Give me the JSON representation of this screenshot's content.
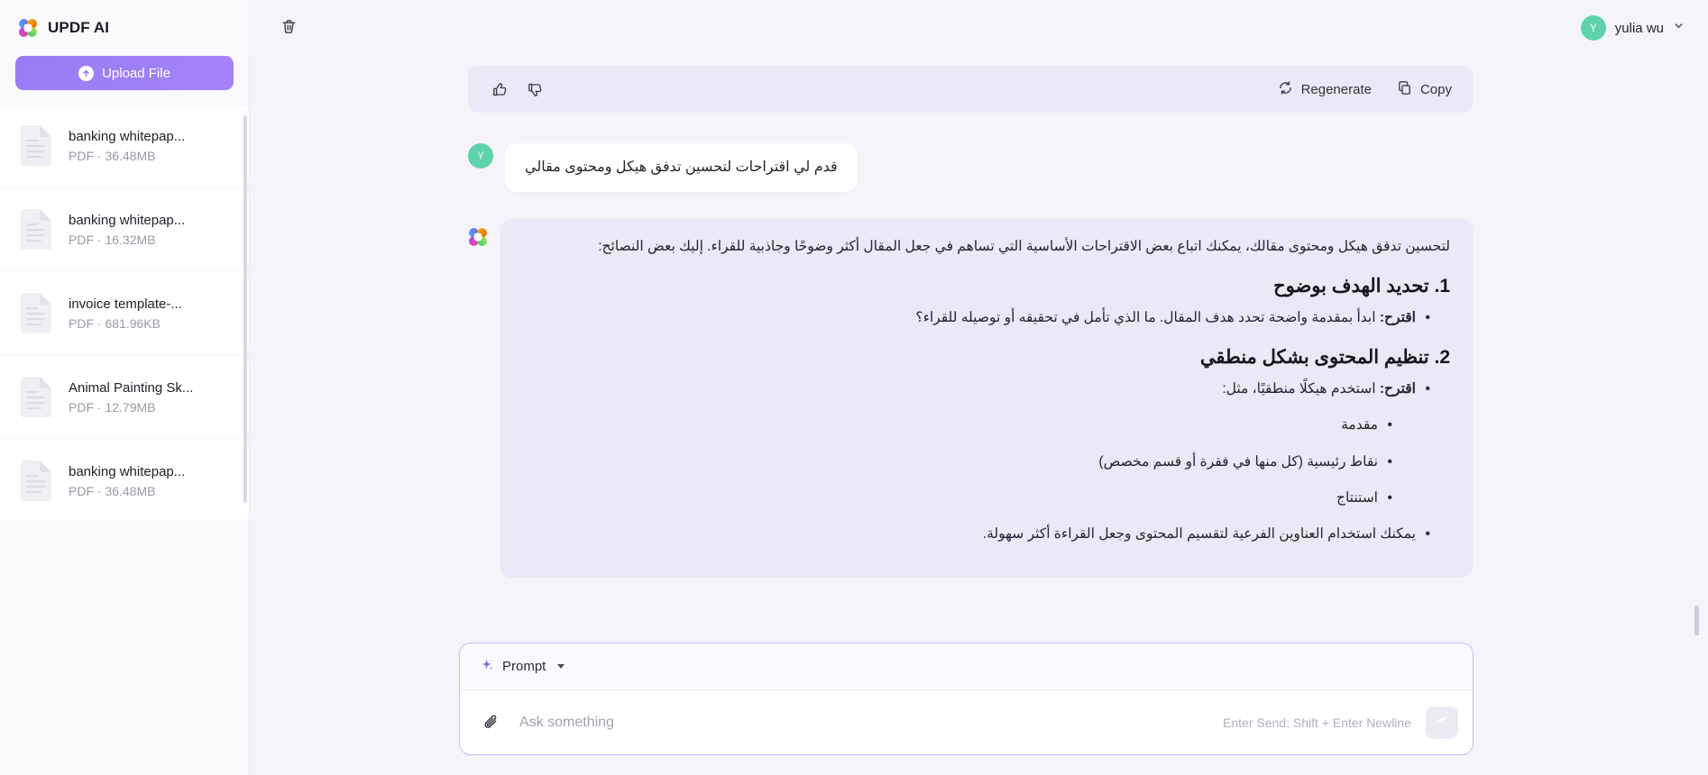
{
  "sidebar": {
    "brand": {
      "name": "UPDF AI",
      "logo_icon": "updf-clover-logo-icon"
    },
    "upload": {
      "label": "Upload File",
      "icon": "upload-arrow-circle-icon"
    },
    "files": [
      {
        "name": "banking whitepap...",
        "meta": "PDF · 36.48MB",
        "icon": "pdf-document-icon"
      },
      {
        "name": "banking whitepap...",
        "meta": "PDF · 16.32MB",
        "icon": "pdf-document-icon"
      },
      {
        "name": "invoice template-...",
        "meta": "PDF · 681.96KB",
        "icon": "pdf-document-icon"
      },
      {
        "name": "Animal Painting Sk...",
        "meta": "PDF · 12.79MB",
        "icon": "pdf-document-icon"
      },
      {
        "name": "banking whitepap...",
        "meta": "PDF · 36.48MB",
        "icon": "pdf-document-icon"
      }
    ]
  },
  "topbar": {
    "trash_icon": "trash-bin-icon",
    "user": {
      "name": "yulia wu",
      "initial": "Y",
      "chevron_icon": "chevron-down-icon"
    }
  },
  "message_toolbar": {
    "thumbs_up_icon": "thumbs-up-icon",
    "thumbs_down_icon": "thumbs-down-icon",
    "regenerate_label": "Regenerate",
    "regenerate_icon": "refresh-icon",
    "copy_label": "Copy",
    "copy_icon": "copy-icon"
  },
  "user_message": {
    "avatar_initial": "Y",
    "text": "قدم لي اقتراحات لتحسين تدفق هيكل ومحتوى مقالي"
  },
  "ai_message": {
    "avatar_icon": "updf-clover-logo-icon",
    "intro": "لتحسين تدفق هيكل ومحتوى مقالك، يمكنك اتباع بعض الاقتراحات الأساسية التي تساهم في جعل المقال أكثر وضوحًا وجاذبية للقراء. إليك بعض النصائح:",
    "section1": {
      "heading": "1. تحديد الهدف بوضوح",
      "bullet1_bold": "اقترح:",
      "bullet1_text": " ابدأ بمقدمة واضحة تحدد هدف المقال. ما الذي تأمل في تحقيقه أو توصيله للقراء؟"
    },
    "section2": {
      "heading": "2. تنظيم المحتوى بشكل منطقي",
      "bullet1_bold": "اقترح:",
      "bullet1_text": " استخدم هيكلًا منطقيًا، مثل:",
      "sub": [
        "مقدمة",
        "نقاط رئيسية (كل منها في فقرة أو قسم مخصص)",
        "استنتاج"
      ],
      "bullet2_text": "يمكنك استخدام العناوين الفرعية لتقسيم المحتوى وجعل القراءة أكثر سهولة."
    }
  },
  "composer": {
    "prompt_label": "Prompt",
    "prompt_icon": "sparkle-icon",
    "caret_icon": "chevron-down-icon",
    "attach_icon": "paperclip-icon",
    "input_value": "",
    "input_placeholder": "Ask something",
    "hint": "Enter Send; Shift + Enter Newline",
    "send_icon": "send-paper-plane-icon"
  },
  "colors": {
    "accent_purple": "#9b7bf5",
    "bubble_ai": "#ebe8f8",
    "avatar_green": "#5fd3ab",
    "page_bg": "#f5f4fa",
    "sidebar_bg": "#faf9fc"
  }
}
